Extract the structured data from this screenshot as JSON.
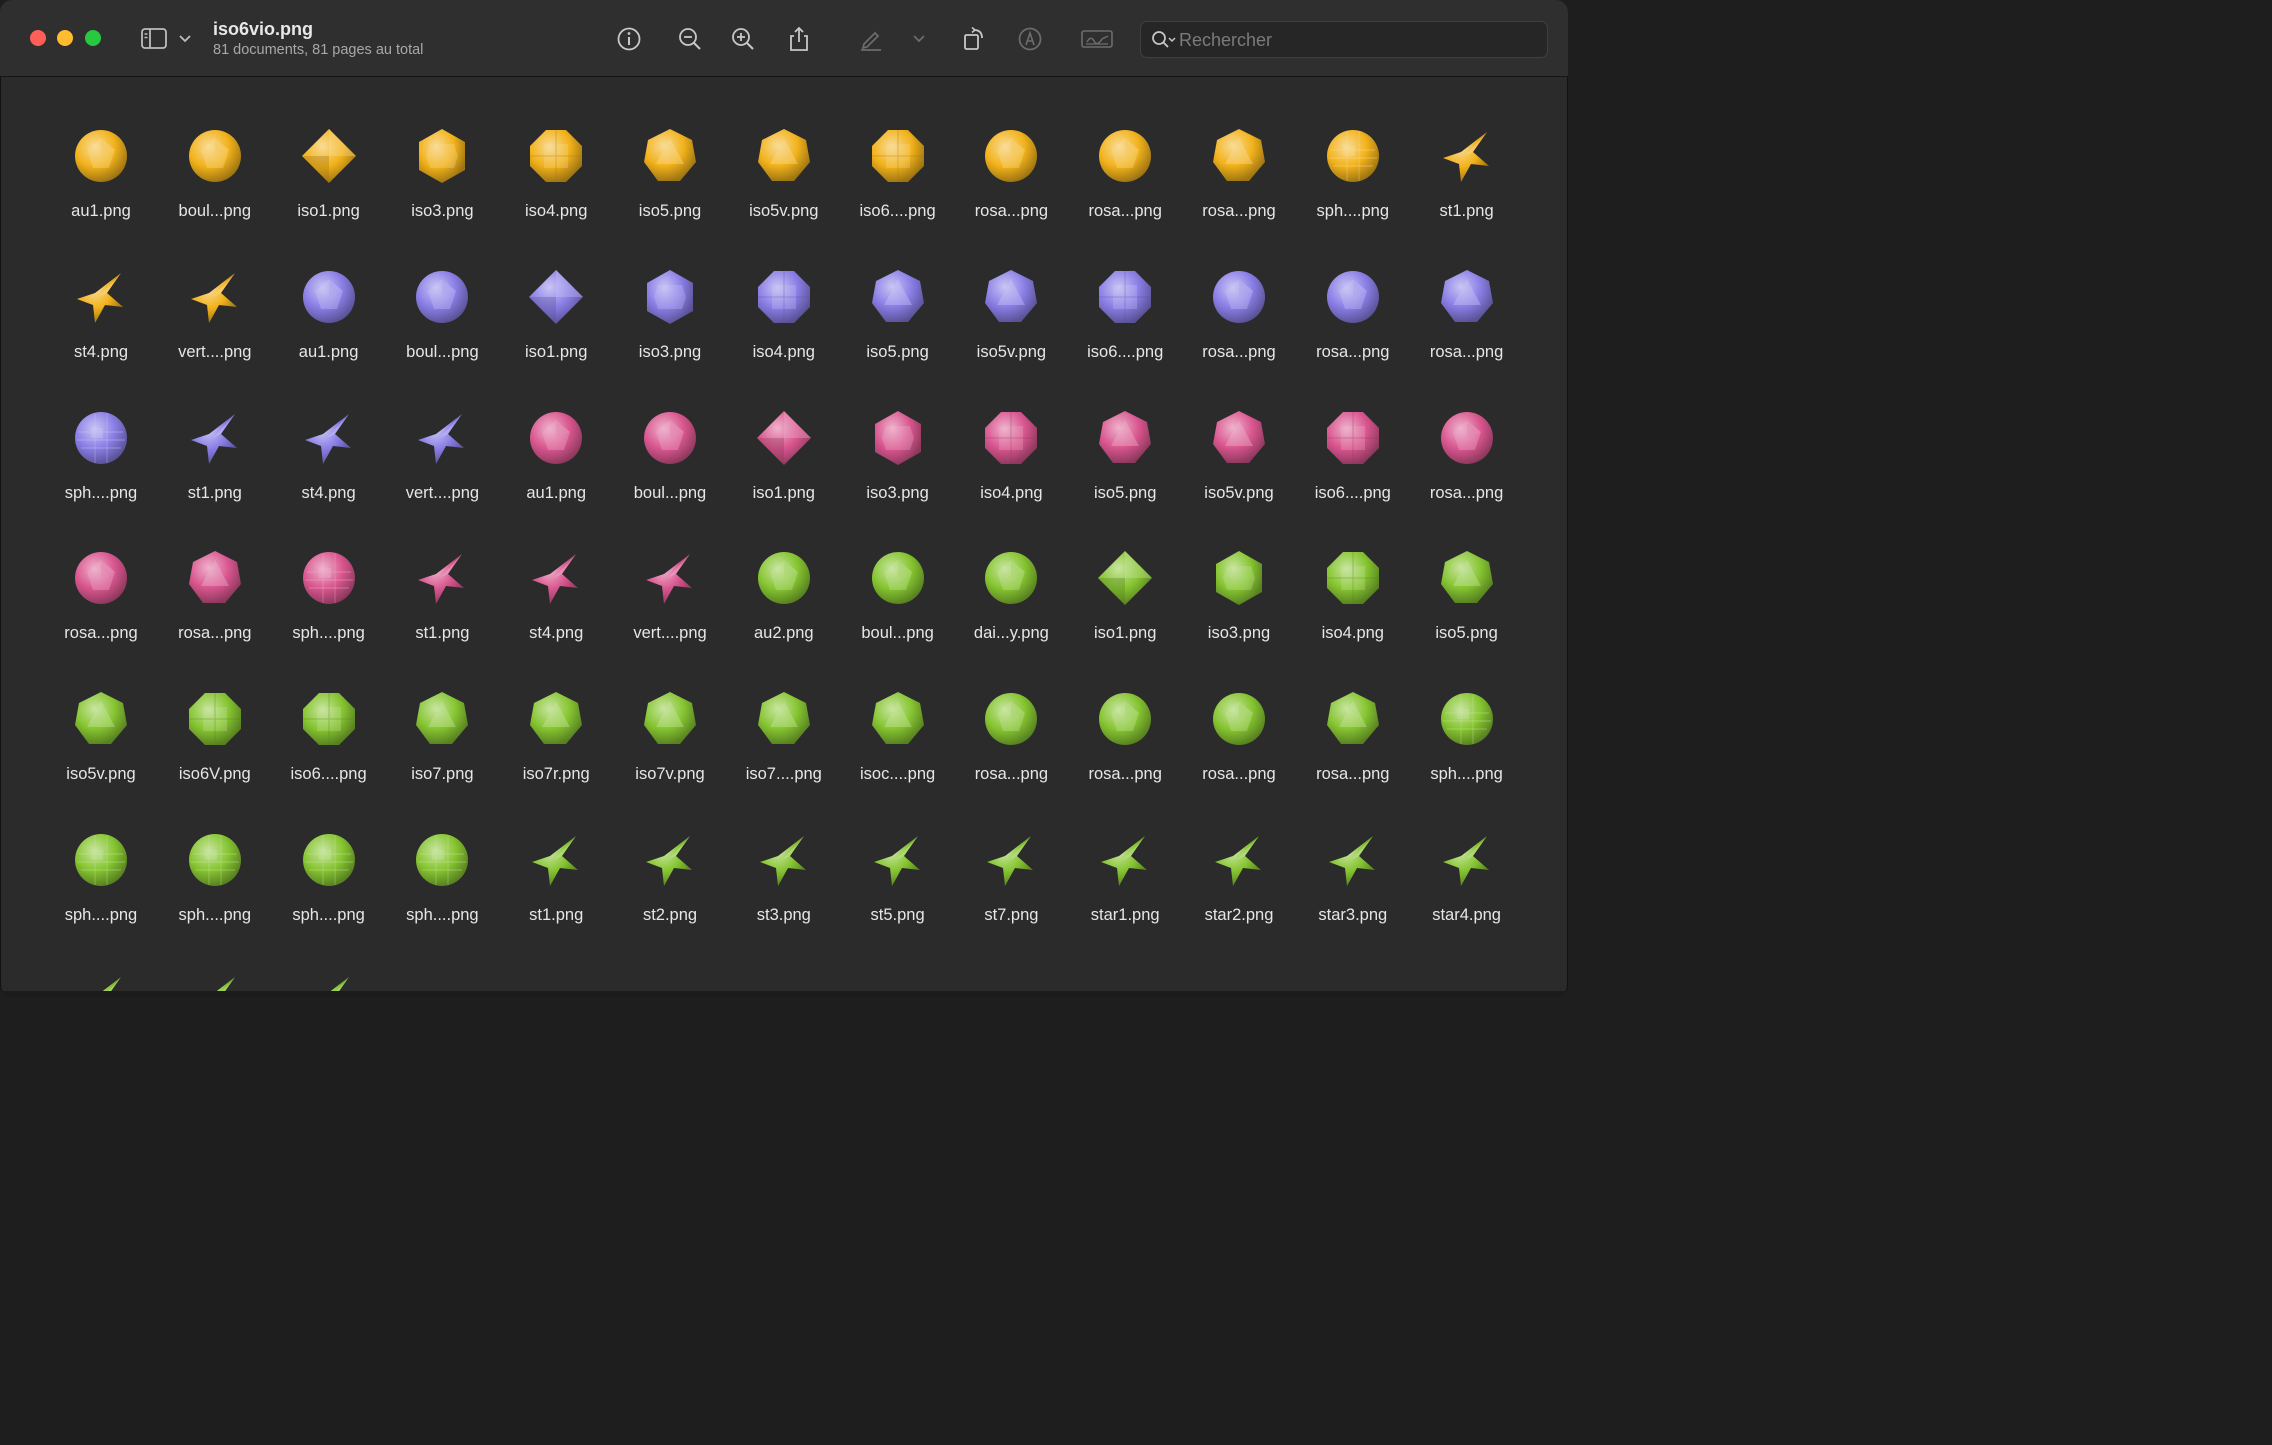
{
  "window": {
    "title": "iso6vio.png",
    "subtitle": "81 documents, 81 pages au total"
  },
  "toolbar": {
    "buttons": [
      "info-icon",
      "zoom-out-icon",
      "zoom-in-icon",
      "share-icon",
      "markup-pen-icon",
      "chevron-down-icon",
      "rotate-icon",
      "highlight-icon",
      "signature-icon"
    ],
    "search_placeholder": "Rechercher"
  },
  "colors": {
    "gold": "#f2b21b",
    "violet": "#8a7ee6",
    "pink": "#d9568f",
    "green": "#86c531"
  },
  "items": [
    {
      "label": "au1.png",
      "color": "gold",
      "shape": "ball"
    },
    {
      "label": "boul...png",
      "color": "gold",
      "shape": "ball"
    },
    {
      "label": "iso1.png",
      "color": "gold",
      "shape": "diamond"
    },
    {
      "label": "iso3.png",
      "color": "gold",
      "shape": "hexagon"
    },
    {
      "label": "iso4.png",
      "color": "gold",
      "shape": "octagon"
    },
    {
      "label": "iso5.png",
      "color": "gold",
      "shape": "polygon"
    },
    {
      "label": "iso5v.png",
      "color": "gold",
      "shape": "polygon"
    },
    {
      "label": "iso6....png",
      "color": "gold",
      "shape": "octagon"
    },
    {
      "label": "rosa...png",
      "color": "gold",
      "shape": "ball"
    },
    {
      "label": "rosa...png",
      "color": "gold",
      "shape": "ball"
    },
    {
      "label": "rosa...png",
      "color": "gold",
      "shape": "polygon"
    },
    {
      "label": "sph....png",
      "color": "gold",
      "shape": "sphere"
    },
    {
      "label": "st1.png",
      "color": "gold",
      "shape": "star"
    },
    {
      "label": "st4.png",
      "color": "gold",
      "shape": "star"
    },
    {
      "label": "vert....png",
      "color": "gold",
      "shape": "star"
    },
    {
      "label": "au1.png",
      "color": "violet",
      "shape": "ball"
    },
    {
      "label": "boul...png",
      "color": "violet",
      "shape": "ball"
    },
    {
      "label": "iso1.png",
      "color": "violet",
      "shape": "diamond"
    },
    {
      "label": "iso3.png",
      "color": "violet",
      "shape": "hexagon"
    },
    {
      "label": "iso4.png",
      "color": "violet",
      "shape": "octagon"
    },
    {
      "label": "iso5.png",
      "color": "violet",
      "shape": "polygon"
    },
    {
      "label": "iso5v.png",
      "color": "violet",
      "shape": "polygon"
    },
    {
      "label": "iso6....png",
      "color": "violet",
      "shape": "octagon"
    },
    {
      "label": "rosa...png",
      "color": "violet",
      "shape": "ball"
    },
    {
      "label": "rosa...png",
      "color": "violet",
      "shape": "ball"
    },
    {
      "label": "rosa...png",
      "color": "violet",
      "shape": "polygon"
    },
    {
      "label": "sph....png",
      "color": "violet",
      "shape": "sphere"
    },
    {
      "label": "st1.png",
      "color": "violet",
      "shape": "star"
    },
    {
      "label": "st4.png",
      "color": "violet",
      "shape": "star"
    },
    {
      "label": "vert....png",
      "color": "violet",
      "shape": "star"
    },
    {
      "label": "au1.png",
      "color": "pink",
      "shape": "ball"
    },
    {
      "label": "boul...png",
      "color": "pink",
      "shape": "ball"
    },
    {
      "label": "iso1.png",
      "color": "pink",
      "shape": "diamond"
    },
    {
      "label": "iso3.png",
      "color": "pink",
      "shape": "hexagon"
    },
    {
      "label": "iso4.png",
      "color": "pink",
      "shape": "octagon"
    },
    {
      "label": "iso5.png",
      "color": "pink",
      "shape": "polygon"
    },
    {
      "label": "iso5v.png",
      "color": "pink",
      "shape": "polygon"
    },
    {
      "label": "iso6....png",
      "color": "pink",
      "shape": "octagon"
    },
    {
      "label": "rosa...png",
      "color": "pink",
      "shape": "ball"
    },
    {
      "label": "rosa...png",
      "color": "pink",
      "shape": "ball"
    },
    {
      "label": "rosa...png",
      "color": "pink",
      "shape": "polygon"
    },
    {
      "label": "sph....png",
      "color": "pink",
      "shape": "sphere"
    },
    {
      "label": "st1.png",
      "color": "pink",
      "shape": "star"
    },
    {
      "label": "st4.png",
      "color": "pink",
      "shape": "star"
    },
    {
      "label": "vert....png",
      "color": "pink",
      "shape": "star"
    },
    {
      "label": "au2.png",
      "color": "green",
      "shape": "ball"
    },
    {
      "label": "boul...png",
      "color": "green",
      "shape": "ball"
    },
    {
      "label": "dai...y.png",
      "color": "green",
      "shape": "ball"
    },
    {
      "label": "iso1.png",
      "color": "green",
      "shape": "diamond"
    },
    {
      "label": "iso3.png",
      "color": "green",
      "shape": "hexagon"
    },
    {
      "label": "iso4.png",
      "color": "green",
      "shape": "octagon"
    },
    {
      "label": "iso5.png",
      "color": "green",
      "shape": "polygon"
    },
    {
      "label": "iso5v.png",
      "color": "green",
      "shape": "polygon"
    },
    {
      "label": "iso6V.png",
      "color": "green",
      "shape": "octagon"
    },
    {
      "label": "iso6....png",
      "color": "green",
      "shape": "octagon"
    },
    {
      "label": "iso7.png",
      "color": "green",
      "shape": "polygon"
    },
    {
      "label": "iso7r.png",
      "color": "green",
      "shape": "polygon"
    },
    {
      "label": "iso7v.png",
      "color": "green",
      "shape": "polygon"
    },
    {
      "label": "iso7....png",
      "color": "green",
      "shape": "polygon"
    },
    {
      "label": "isoc....png",
      "color": "green",
      "shape": "polygon"
    },
    {
      "label": "rosa...png",
      "color": "green",
      "shape": "ball"
    },
    {
      "label": "rosa...png",
      "color": "green",
      "shape": "ball"
    },
    {
      "label": "rosa...png",
      "color": "green",
      "shape": "ball"
    },
    {
      "label": "rosa...png",
      "color": "green",
      "shape": "polygon"
    },
    {
      "label": "sph....png",
      "color": "green",
      "shape": "sphere"
    },
    {
      "label": "sph....png",
      "color": "green",
      "shape": "sphere"
    },
    {
      "label": "sph....png",
      "color": "green",
      "shape": "sphere"
    },
    {
      "label": "sph....png",
      "color": "green",
      "shape": "sphere"
    },
    {
      "label": "sph....png",
      "color": "green",
      "shape": "sphere"
    },
    {
      "label": "st1.png",
      "color": "green",
      "shape": "star"
    },
    {
      "label": "st2.png",
      "color": "green",
      "shape": "star"
    },
    {
      "label": "st3.png",
      "color": "green",
      "shape": "star"
    },
    {
      "label": "st5.png",
      "color": "green",
      "shape": "star"
    },
    {
      "label": "st7.png",
      "color": "green",
      "shape": "star"
    },
    {
      "label": "star1.png",
      "color": "green",
      "shape": "star"
    },
    {
      "label": "star2.png",
      "color": "green",
      "shape": "star"
    },
    {
      "label": "star3.png",
      "color": "green",
      "shape": "star"
    },
    {
      "label": "star4.png",
      "color": "green",
      "shape": "star"
    },
    {
      "label": "",
      "color": "green",
      "shape": "star"
    },
    {
      "label": "",
      "color": "green",
      "shape": "star"
    },
    {
      "label": "",
      "color": "green",
      "shape": "star"
    }
  ]
}
